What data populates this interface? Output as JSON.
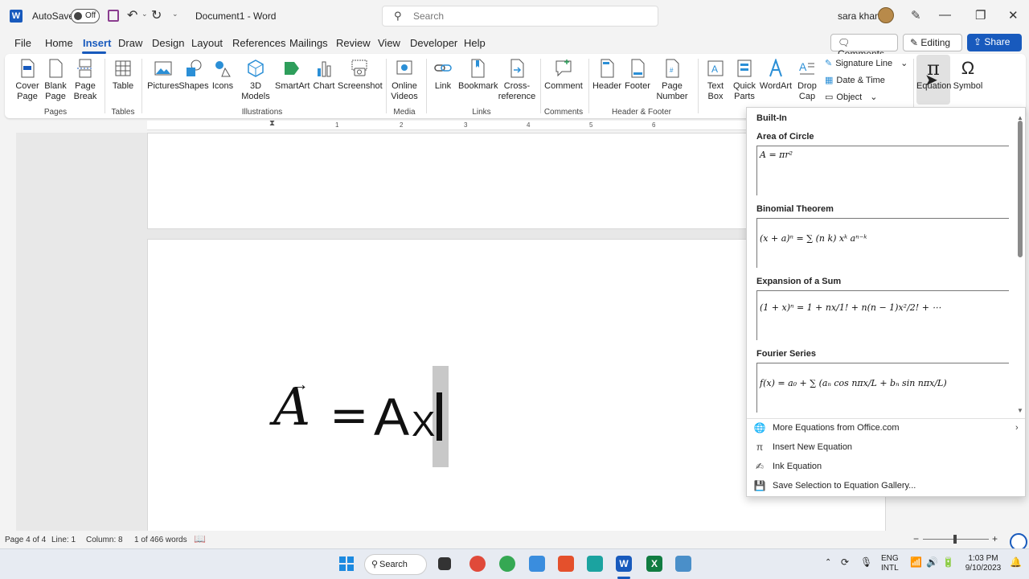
{
  "titlebar": {
    "autosave_label": "AutoSave",
    "toggle_state": "Off",
    "doc_title": "Document1  -  Word",
    "search_placeholder": "Search",
    "user_name": "sara khan"
  },
  "tabs": [
    "File",
    "Home",
    "Insert",
    "Draw",
    "Design",
    "Layout",
    "References",
    "Mailings",
    "Review",
    "View",
    "Developer",
    "Help"
  ],
  "active_tab": "Insert",
  "right_buttons": {
    "comments": "Comments",
    "editing": "Editing",
    "share": "Share"
  },
  "ribbon": {
    "pages": {
      "cover": "Cover\nPage",
      "blank": "Blank\nPage",
      "break": "Page\nBreak",
      "label": "Pages"
    },
    "tables": {
      "table": "Table",
      "label": "Tables"
    },
    "illustrations": {
      "pictures": "Pictures",
      "shapes": "Shapes",
      "icons": "Icons",
      "models": "3D\nModels",
      "smartart": "SmartArt",
      "chart": "Chart",
      "screenshot": "Screenshot",
      "label": "Illustrations"
    },
    "media": {
      "videos": "Online\nVideos",
      "label": "Media"
    },
    "links": {
      "link": "Link",
      "bookmark": "Bookmark",
      "crossref": "Cross-\nreference",
      "label": "Links"
    },
    "comments": {
      "comment": "Comment",
      "label": "Comments"
    },
    "header_footer": {
      "header": "Header",
      "footer": "Footer",
      "pagenum": "Page\nNumber",
      "label": "Header & Footer"
    },
    "text": {
      "textbox": "Text\nBox",
      "quickparts": "Quick\nParts",
      "wordart": "WordArt",
      "dropcap": "Drop\nCap",
      "sigline": "Signature Line",
      "datetime": "Date & Time",
      "object": "Object"
    },
    "symbols": {
      "equation": "Equation",
      "symbol": "Symbol"
    }
  },
  "ruler_ticks": [
    "1",
    "2",
    "3",
    "4",
    "5",
    "6"
  ],
  "document": {
    "eq_vector": "A",
    "eq_equals": "=",
    "eq_main": "A",
    "eq_sub": "X"
  },
  "equation_gallery": {
    "header": "Built-In",
    "items": [
      {
        "title": "Area of Circle",
        "formula": "A = πr²"
      },
      {
        "title": "Binomial Theorem",
        "formula": "(x + a)ⁿ = ∑ (n k) xᵏ aⁿ⁻ᵏ"
      },
      {
        "title": "Expansion of a Sum",
        "formula": "(1 + x)ⁿ = 1 + nx/1! + n(n − 1)x²/2! + ⋯"
      },
      {
        "title": "Fourier Series",
        "formula": "f(x) = a₀ + ∑ (aₙ cos nπx/L + bₙ sin nπx/L)"
      }
    ],
    "menu": [
      "More Equations from Office.com",
      "Insert New Equation",
      "Ink Equation",
      "Save Selection to Equation Gallery..."
    ]
  },
  "statusbar": {
    "page": "Page 4 of 4",
    "line": "Line: 1",
    "column": "Column: 8",
    "words": "1 of 466 words"
  },
  "taskbar": {
    "search": "Search",
    "lang_top": "ENG",
    "lang_bottom": "INTL",
    "time": "1:03 PM",
    "date": "9/10/2023"
  },
  "colors": {
    "accent": "#185abd",
    "word_blue": "#185abd",
    "excel_green": "#107c41"
  }
}
